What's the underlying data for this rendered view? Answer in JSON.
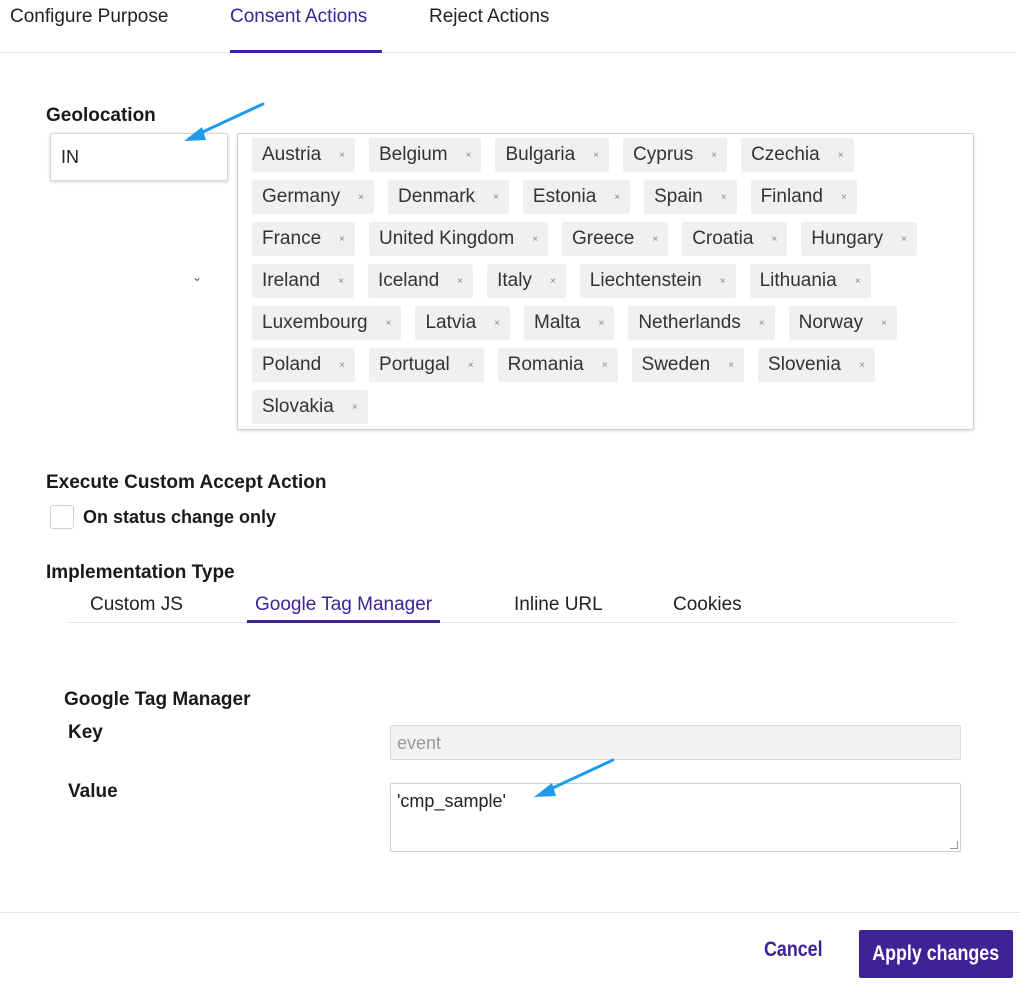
{
  "tabs": [
    "Configure Purpose",
    "Consent Actions",
    "Reject Actions"
  ],
  "geolocation": {
    "title": "Geolocation",
    "selected": "IN",
    "countries": [
      [
        "Austria",
        "Belgium",
        "Bulgaria",
        "Cyprus",
        "Czechia"
      ],
      [
        "Germany",
        "Denmark",
        "Estonia",
        "Spain",
        "Finland"
      ],
      [
        "France",
        "United Kingdom",
        "Greece",
        "Croatia",
        "Hungary"
      ],
      [
        "Ireland",
        "Iceland",
        "Italy",
        "Liechtenstein",
        "Lithuania"
      ],
      [
        "Luxembourg",
        "Latvia",
        "Malta",
        "Netherlands",
        "Norway"
      ],
      [
        "Poland",
        "Portugal",
        "Romania",
        "Sweden",
        "Slovenia"
      ],
      [
        "Slovakia"
      ]
    ],
    "remove_glyph": "×",
    "chevron": "⌄"
  },
  "custom_accept": {
    "title": "Execute Custom Accept Action",
    "checkbox_label": "On status change only",
    "checked": false
  },
  "implementation": {
    "title": "Implementation Type",
    "tabs": [
      "Custom JS",
      "Google Tag Manager",
      "Inline URL",
      "Cookies"
    ],
    "active_tab": "Google Tag Manager"
  },
  "gtm": {
    "title": "Google Tag Manager",
    "key_label": "Key",
    "key_value": "event",
    "value_label": "Value",
    "value_value": "'cmp_sample'"
  },
  "footer": {
    "cancel_label": "Cancel",
    "apply_label": "Apply changes"
  },
  "colors": {
    "accent": "#3d2396",
    "annotation_arrow": "#1e9bea"
  }
}
